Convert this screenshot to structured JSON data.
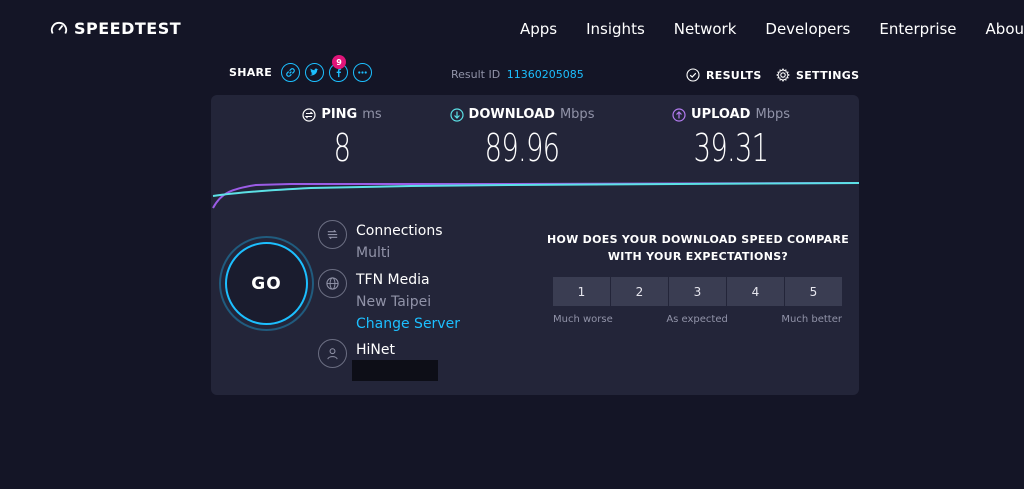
{
  "header": {
    "logo_text": "SPEEDTEST",
    "nav": [
      "Apps",
      "Insights",
      "Network",
      "Developers",
      "Enterprise",
      "Abou"
    ]
  },
  "share": {
    "label": "SHARE",
    "badge": "9"
  },
  "result": {
    "label": "Result ID",
    "id": "11360205085"
  },
  "actions": {
    "results_label": "RESULTS",
    "settings_label": "SETTINGS"
  },
  "metrics": {
    "ping": {
      "label": "PING",
      "unit": "ms",
      "value": "8"
    },
    "download": {
      "label": "DOWNLOAD",
      "unit": "Mbps",
      "value": "89.96"
    },
    "upload": {
      "label": "UPLOAD",
      "unit": "Mbps",
      "value": "39.31"
    }
  },
  "go_label": "GO",
  "connections": {
    "title": "Connections",
    "value": "Multi"
  },
  "server": {
    "name": "TFN Media",
    "location": "New Taipei",
    "change_link": "Change Server"
  },
  "isp": {
    "name": "HiNet"
  },
  "compare": {
    "question_line1": "HOW DOES YOUR DOWNLOAD SPEED COMPARE",
    "question_line2": "WITH YOUR EXPECTATIONS?",
    "options": [
      "1",
      "2",
      "3",
      "4",
      "5"
    ],
    "label_low": "Much worse",
    "label_mid": "As expected",
    "label_high": "Much better"
  },
  "colors": {
    "accent": "#1cbfff",
    "download_graph": "#5ce1e6",
    "upload_graph": "#9b5ce6",
    "background": "#141526",
    "panel": "#232539"
  }
}
